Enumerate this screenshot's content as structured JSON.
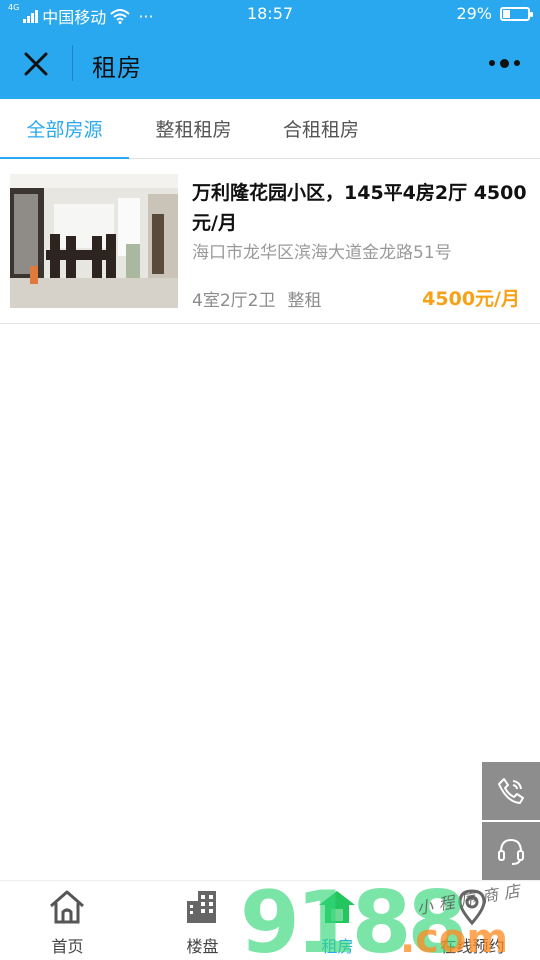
{
  "status_bar": {
    "network_badge": "4G",
    "carrier": "中国移动",
    "more": "···",
    "time": "18:57",
    "battery_text": "29%",
    "battery_level": 0.29
  },
  "header": {
    "title": "租房"
  },
  "tabs": [
    {
      "label": "全部房源",
      "active": true
    },
    {
      "label": "整租租房",
      "active": false
    },
    {
      "label": "合租租房",
      "active": false
    }
  ],
  "listings": [
    {
      "title": "万利隆花园小区，145平4房2厅 4500元/月",
      "address": "海口市龙华区滨海大道金龙路51号",
      "layout": "4室2厅2卫",
      "rent_type": "整租",
      "price": "4500元/月"
    }
  ],
  "bottom_nav": [
    {
      "label": "首页",
      "icon": "home-icon"
    },
    {
      "label": "楼盘",
      "icon": "building-icon"
    },
    {
      "label": "租房",
      "icon": "rent-house-icon"
    },
    {
      "label": "在线预约",
      "icon": "location-pin-icon"
    }
  ],
  "watermark": {
    "brand": "9188",
    "tld": ".com",
    "tagline": "小程序商店"
  },
  "colors": {
    "primary": "#2aa8ef",
    "price": "#f7a116",
    "float_button": "#8d8d8d",
    "active_tab_icon": "#22c55e"
  }
}
